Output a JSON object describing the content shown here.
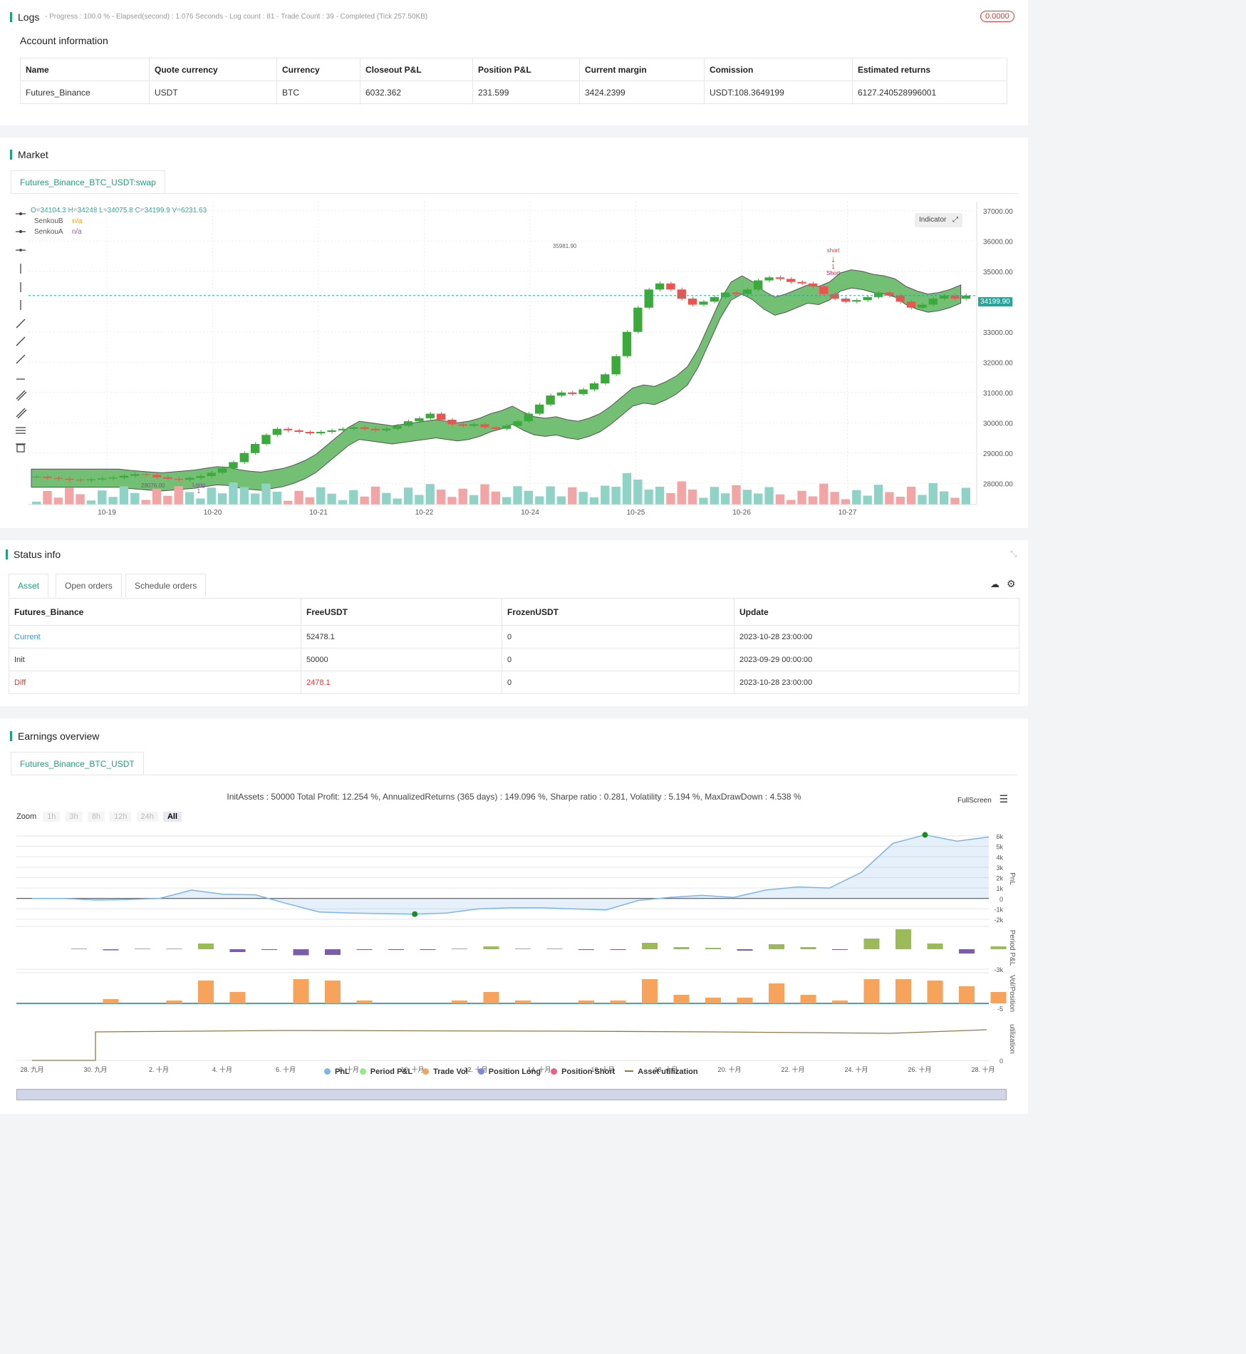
{
  "logs": {
    "title": "Logs",
    "status_line": "- Progress : 100.0 % - Elapsed(second) : 1.076  Seconds - Log count : 81 - Trade Count : 39 - Completed (Tick 257.50KB)",
    "badge": "0.0000",
    "account_title": "Account information",
    "columns": [
      "Name",
      "Quote currency",
      "Currency",
      "Closeout P&L",
      "Position P&L",
      "Current margin",
      "Comission",
      "Estimated returns"
    ],
    "row": [
      "Futures_Binance",
      "USDT",
      "BTC",
      "6032.362",
      "231.599",
      "3424.2399",
      "USDT:108.3649199",
      "6127.240528996001"
    ]
  },
  "market": {
    "title": "Market",
    "tab": "Futures_Binance_BTC_USDT:swap",
    "ohlc": "O=34104.3  H=34248  L=34075.8  C=34199.9  V=6231.63",
    "legend": [
      {
        "name": "SenkouB",
        "value": "n/a",
        "color": "#f39c12"
      },
      {
        "name": "SenkouA",
        "value": "n/a",
        "color": "#9b59b6"
      }
    ],
    "indicator_btn": "Indicator",
    "price_tag": "34199.90",
    "high_label": "35981.90",
    "low_label": "28076.00",
    "markers": {
      "long": "Long",
      "long_qty": "1",
      "short": "short",
      "short_qty": "1",
      "short2": "Short"
    },
    "colors": {
      "up": "#3aab3a",
      "down": "#ef5350",
      "cloud": "#5ab45a",
      "cloud_line": "#555555",
      "price_line": "#26a69a"
    }
  },
  "status": {
    "title": "Status info",
    "tabs": [
      "Asset",
      "Open orders",
      "Schedule orders"
    ],
    "columns": [
      "Futures_Binance",
      "FreeUSDT",
      "FrozenUSDT",
      "Update"
    ],
    "rows": [
      {
        "label": "Current",
        "free": "52478.1",
        "frozen": "0",
        "update": "2023-10-28 23:00:00"
      },
      {
        "label": "Init",
        "free": "50000",
        "frozen": "0",
        "update": "2023-09-29 00:00:00"
      },
      {
        "label": "Diff",
        "free": "2478.1",
        "frozen": "0",
        "update": "2023-10-28 23:00:00"
      }
    ]
  },
  "earnings": {
    "title": "Earnings overview",
    "tab": "Futures_Binance_BTC_USDT",
    "summary": "InitAssets : 50000 Total Profit: 12.254 %, AnnualizedReturns (365 days) : 149.096 %, Sharpe ratio : 0.281, Volatility : 5.194 %, MaxDrawDown : 4.538 %",
    "fullscreen": "FullScreen",
    "zoom_label": "Zoom",
    "zoom_options": [
      "1h",
      "3h",
      "8h",
      "12h",
      "24h",
      "All"
    ],
    "legend": [
      {
        "name": "PnL",
        "color": "#7cb5ec"
      },
      {
        "name": "Period P&L",
        "color": "#90ed7d"
      },
      {
        "name": "Trade Vol",
        "color": "#f7a35c"
      },
      {
        "name": "Position Long",
        "color": "#8085e9"
      },
      {
        "name": "Position Short",
        "color": "#f15c80"
      },
      {
        "name": "Asset utilization",
        "color": "#8d7a4a"
      }
    ],
    "axis_titles": [
      "PnL",
      "Period P&L",
      "Vol/Position",
      "utilization"
    ]
  },
  "chart_data": [
    {
      "type": "candlestick",
      "x_ticks": [
        "10-19",
        "10-20",
        "10-21",
        "10-22",
        "10-24",
        "10-25",
        "10-26",
        "10-27"
      ],
      "y_ticks": [
        28000,
        29000,
        30000,
        31000,
        32000,
        33000,
        34000,
        35000,
        36000,
        37000
      ],
      "ylim": [
        27300,
        37300
      ],
      "last_price": 34199.9,
      "series_close": [
        28220,
        28180,
        28150,
        28120,
        28100,
        28130,
        28160,
        28190,
        28250,
        28300,
        28280,
        28200,
        28150,
        28120,
        28180,
        28240,
        28350,
        28500,
        28700,
        29000,
        29300,
        29600,
        29800,
        29750,
        29700,
        29650,
        29700,
        29750,
        29800,
        29850,
        29800,
        29750,
        29800,
        29900,
        30050,
        30150,
        30300,
        30100,
        29950,
        29900,
        29950,
        29850,
        29800,
        29900,
        30050,
        30300,
        30600,
        30900,
        31000,
        30950,
        31100,
        31300,
        31600,
        32200,
        33000,
        33800,
        34400,
        34600,
        34400,
        34100,
        33900,
        34000,
        34150,
        34300,
        34250,
        34400,
        34700,
        34800,
        34750,
        34650,
        34600,
        34500,
        34250,
        34100,
        34000,
        34050,
        34150,
        34300,
        34200,
        34000,
        33800,
        33900,
        34100,
        34200,
        34100,
        34200
      ]
    },
    {
      "type": "line",
      "x_ticks": [
        "28. 九月",
        "30. 九月",
        "2. 十月",
        "4. 十月",
        "6. 十月",
        "8. 十月",
        "10. 十月",
        "12. 十月",
        "14. 十月",
        "16. 十月",
        "18. 十月",
        "20. 十月",
        "22. 十月",
        "24. 十月",
        "26. 十月",
        "28. 十月"
      ],
      "pnl_ticks": [
        "6k",
        "5k",
        "4k",
        "3k",
        "2k",
        "1k",
        "0",
        "-1k",
        "-2k"
      ],
      "pnl_values": [
        0,
        0,
        -150,
        -100,
        0,
        800,
        400,
        350,
        -500,
        -1300,
        -1400,
        -1450,
        -1500,
        -1400,
        -1000,
        -900,
        -900,
        -1000,
        -1100,
        -200,
        100,
        300,
        100,
        800,
        1100,
        1000,
        2500,
        5300,
        6100,
        5500,
        5900
      ],
      "period_ticks": [
        "-3k"
      ],
      "vol_ticks": [
        "-5"
      ],
      "util_ticks": [
        "0"
      ]
    }
  ]
}
